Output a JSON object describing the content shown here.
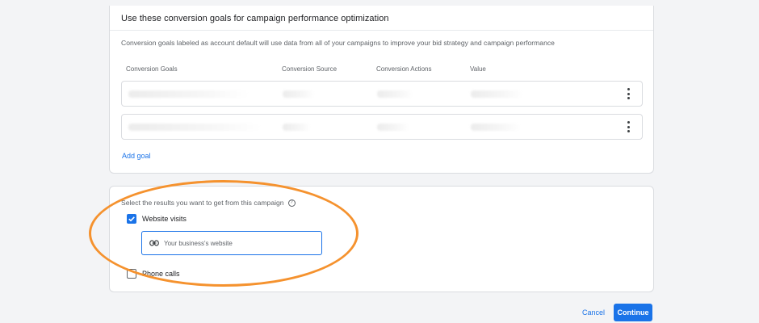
{
  "goals_card": {
    "title": "Use these conversion goals for campaign performance optimization",
    "description": "Conversion goals labeled as account default will use data from all of your campaigns to improve your bid strategy and campaign performance",
    "columns": [
      "Conversion Goals",
      "Conversion Source",
      "Conversion Actions",
      "Value"
    ],
    "rows_count_note": "",
    "add_goal_label": "Add goal"
  },
  "results_card": {
    "prompt": "Select the results you want to get from this campaign",
    "options": [
      {
        "label": "Website visits",
        "checked": true
      },
      {
        "label": "Phone calls",
        "checked": false
      }
    ],
    "website_input": {
      "value": "",
      "placeholder": "Your business's website"
    }
  },
  "footer": {
    "cancel_label": "Cancel",
    "continue_label": "Continue"
  },
  "colors": {
    "accent": "#1a73e8",
    "highlight": "#f5922e",
    "background": "#f3f4f6"
  },
  "icons": {
    "help": "help-circle-icon",
    "link": "link-icon",
    "more": "more-vert-icon",
    "check": "check-icon"
  }
}
